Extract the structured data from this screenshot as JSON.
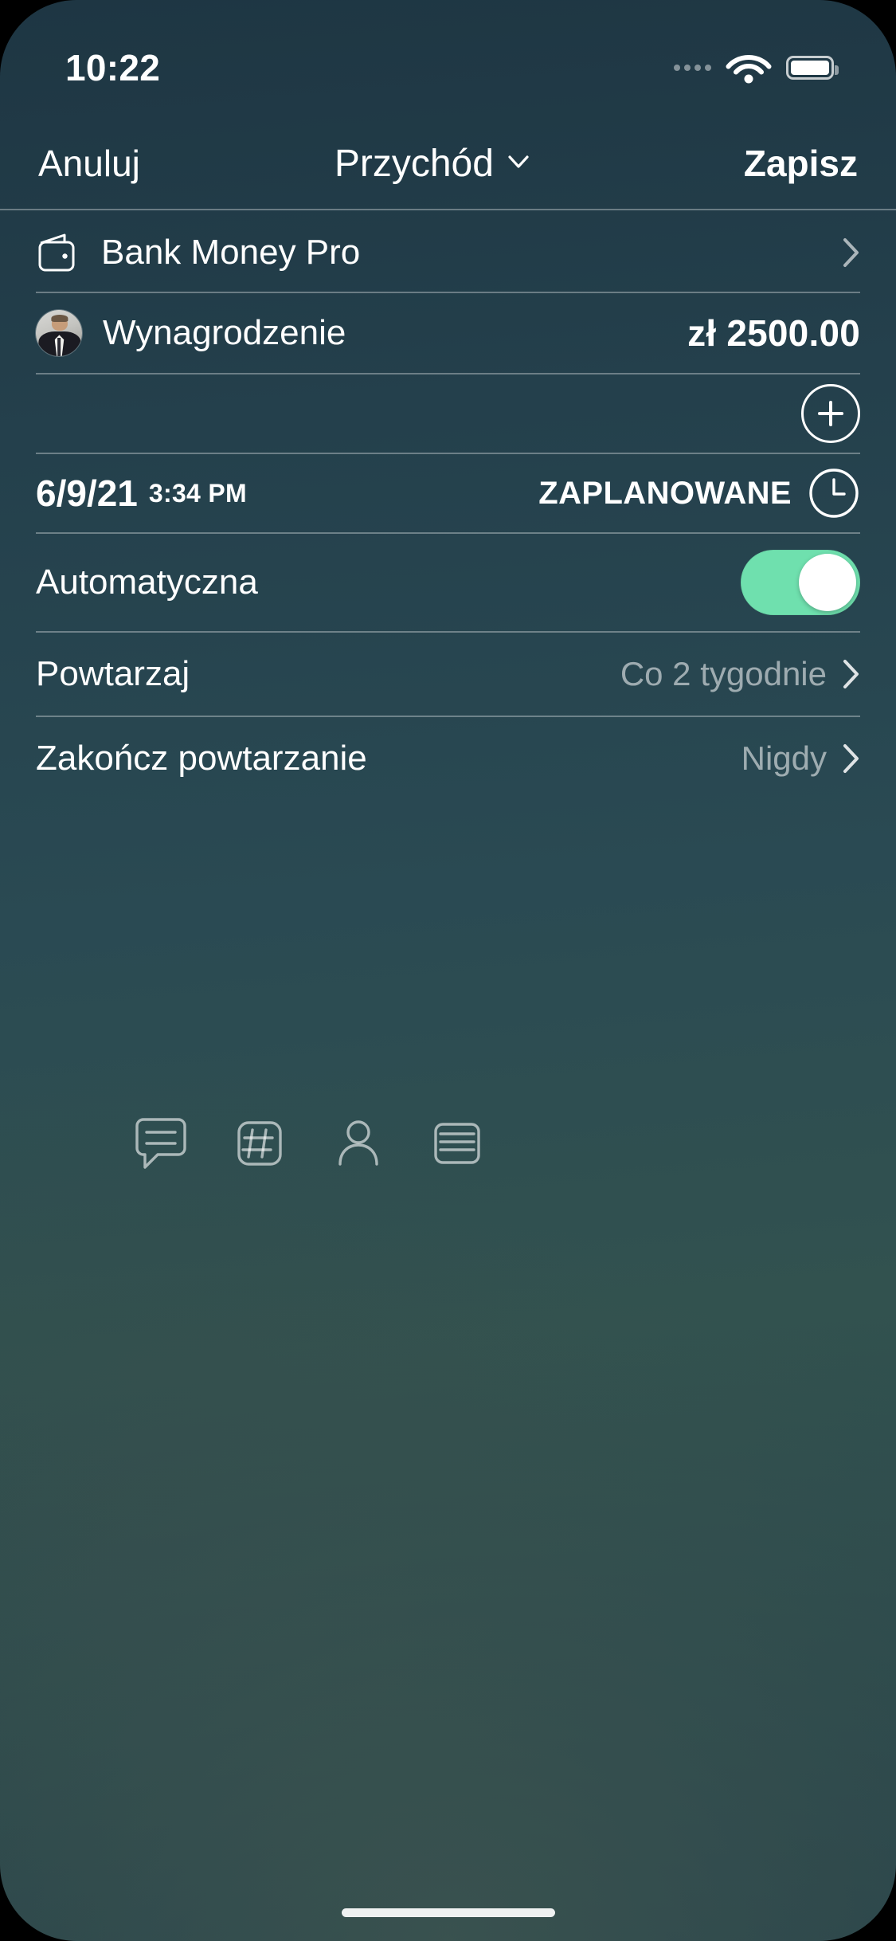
{
  "status_bar": {
    "time": "10:22",
    "signal_icon": "signal-dots-icon",
    "wifi_icon": "wifi-icon",
    "battery_icon": "battery-full-icon"
  },
  "nav_bar": {
    "cancel_label": "Anuluj",
    "title": "Przychód",
    "title_chevron_icon": "chevron-down-icon",
    "save_label": "Zapisz"
  },
  "account_row": {
    "icon": "wallet-icon",
    "label": "Bank Money Pro",
    "disclosure_icon": "chevron-right-icon"
  },
  "transaction_row": {
    "avatar": "person-avatar",
    "category": "Wynagrodzenie",
    "amount": "zł 2500.00"
  },
  "add_row": {
    "add_icon": "plus-circle-icon"
  },
  "date_row": {
    "date": "6/9/21",
    "time": "3:34 PM",
    "status": "ZAPLANOWANE",
    "clock_icon": "clock-icon"
  },
  "auto_row": {
    "label": "Automatyczna",
    "toggle_state": "on",
    "toggle_on_color": "#6fe0ae",
    "toggle_knob_color": "#ffffff"
  },
  "repeat_row": {
    "label": "Powtarzaj",
    "value": "Co 2 tygodnie",
    "disclosure_icon": "chevron-right-icon"
  },
  "repeat_end_row": {
    "label": "Zakończ powtarzanie",
    "value": "Nigdy",
    "disclosure_icon": "chevron-right-icon"
  },
  "icon_bar": {
    "items": [
      {
        "name": "note-icon",
        "title": "note"
      },
      {
        "name": "tags-icon",
        "title": "tags"
      },
      {
        "name": "payee-icon",
        "title": "payee"
      },
      {
        "name": "attachment-icon",
        "title": "attachment"
      }
    ]
  },
  "theme": {
    "background_top": "#1e3643",
    "background_mid": "#2a4a53",
    "background_bottom": "#27424a",
    "text_primary": "#ffffff",
    "text_muted": "rgba(255,255,255,0.55)",
    "separator": "rgba(255,255,255,0.33)",
    "accent_green": "#6fe0ae"
  }
}
